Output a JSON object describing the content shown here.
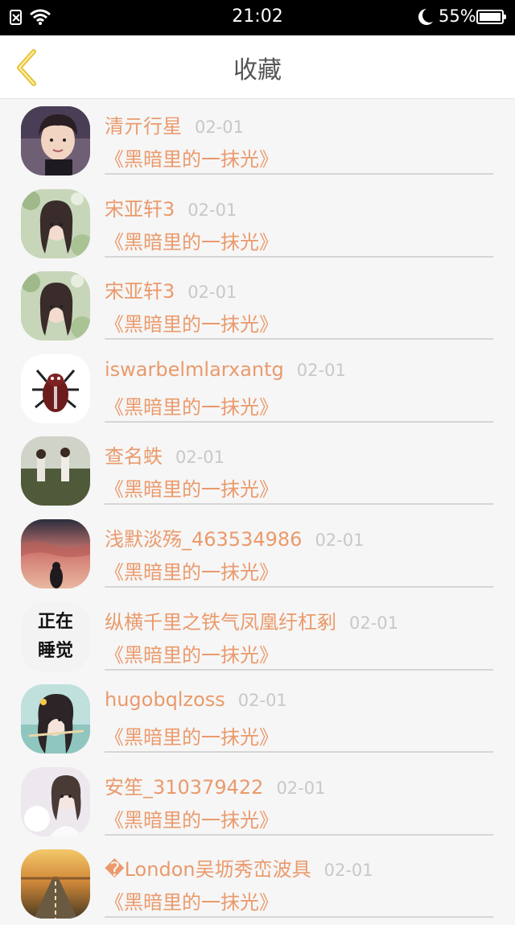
{
  "status_bar": {
    "time": "21:02",
    "battery": "55%",
    "battery_level": 0.55,
    "icons": [
      "sim-card-icon",
      "wifi-icon",
      "moon-icon",
      "battery-icon"
    ]
  },
  "header": {
    "title": "收藏",
    "back_icon": "chevron-left-icon"
  },
  "colors": {
    "accent_orange": "#ea9a6c",
    "back_arrow_yellow": "#e8c23a",
    "date_gray": "#c8c8c8",
    "status_bar_bg": "#000000"
  },
  "items": [
    {
      "name": "清亓行星",
      "date": "02-01",
      "title": "《黑暗里的一抹光》",
      "avatar": "photo-boy"
    },
    {
      "name": "宋亚轩3",
      "date": "02-01",
      "title": "《黑暗里的一抹光》",
      "avatar": "photo-girl-flowers"
    },
    {
      "name": "宋亚轩3",
      "date": "02-01",
      "title": "《黑暗里的一抹光》",
      "avatar": "photo-girl-flowers"
    },
    {
      "name": "iswarbelmlarxantg",
      "date": "02-01",
      "title": "《黑暗里的一抹光》",
      "avatar": "spider-emblem"
    },
    {
      "name": "查名蛈",
      "date": "02-01",
      "title": "《黑暗里的一抹光》",
      "avatar": "photo-two-girls-field"
    },
    {
      "name": "浅默淡殇_463534986",
      "date": "02-01",
      "title": "《黑暗里的一抹光》",
      "avatar": "photo-sunset-sky"
    },
    {
      "name": "纵横千里之铁气凤凰纡杠剢",
      "date": "02-01",
      "title": "《黑暗里的一抹光》",
      "avatar": "text",
      "avatar_text": [
        "正在",
        "睡觉"
      ]
    },
    {
      "name": "hugobqlzoss",
      "date": "02-01",
      "title": "《黑暗里的一抹光》",
      "avatar": "photo-anime-girl"
    },
    {
      "name": "安笙_310379422",
      "date": "02-01",
      "title": "《黑暗里的一抹光》",
      "avatar": "photo-girl-white"
    },
    {
      "name": "�London吴坜秀峦波具",
      "date": "02-01",
      "title": "《黑暗里的一抹光》",
      "avatar": "photo-road-sunset"
    }
  ]
}
